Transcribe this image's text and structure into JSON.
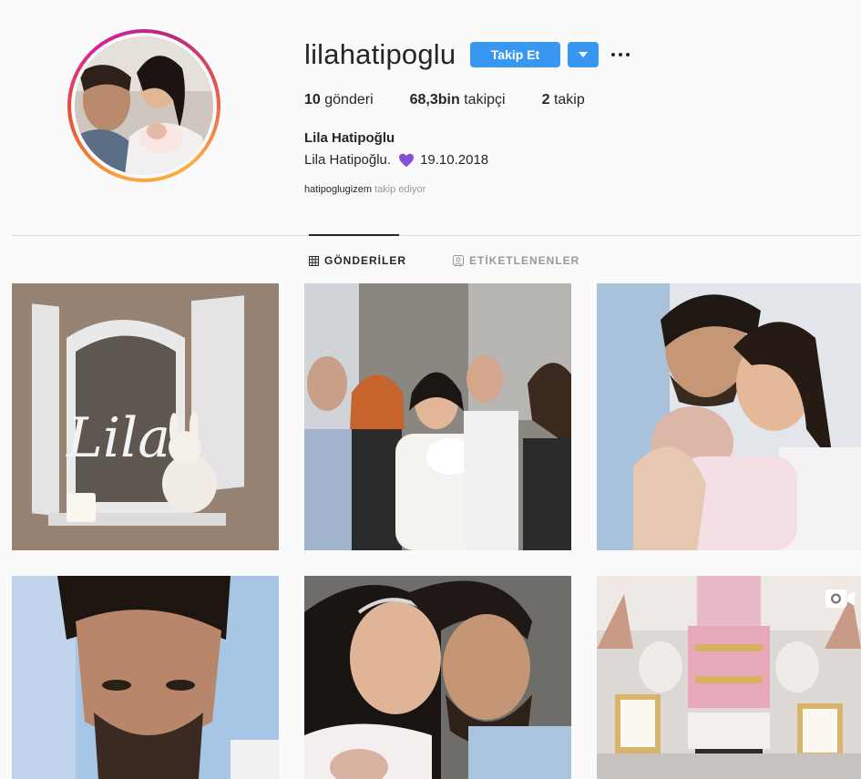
{
  "profile": {
    "username": "lilahatipoglu",
    "follow_label": "Takip Et",
    "stats": {
      "posts_count": "10",
      "posts_label": "gönderi",
      "followers_count": "68,3bin",
      "followers_label": "takipçi",
      "following_count": "2",
      "following_label": "takip"
    },
    "full_name": "Lila Hatipoğlu",
    "bio_text": "Lila Hatipoğlu.",
    "bio_date": "19.10.2018",
    "followed_by_user": "hatipoglugizem",
    "followed_by_text": "takip ediyor"
  },
  "tabs": [
    {
      "label": "GÖNDERİLER",
      "icon": "grid-icon",
      "active": true
    },
    {
      "label": "ETİKETLENENLER",
      "icon": "tagged-icon",
      "active": false
    }
  ],
  "colors": {
    "accent": "#3897f0",
    "heart": "#8a4fd8",
    "ring_start": "#f9a23a",
    "ring_end": "#d6249f"
  }
}
